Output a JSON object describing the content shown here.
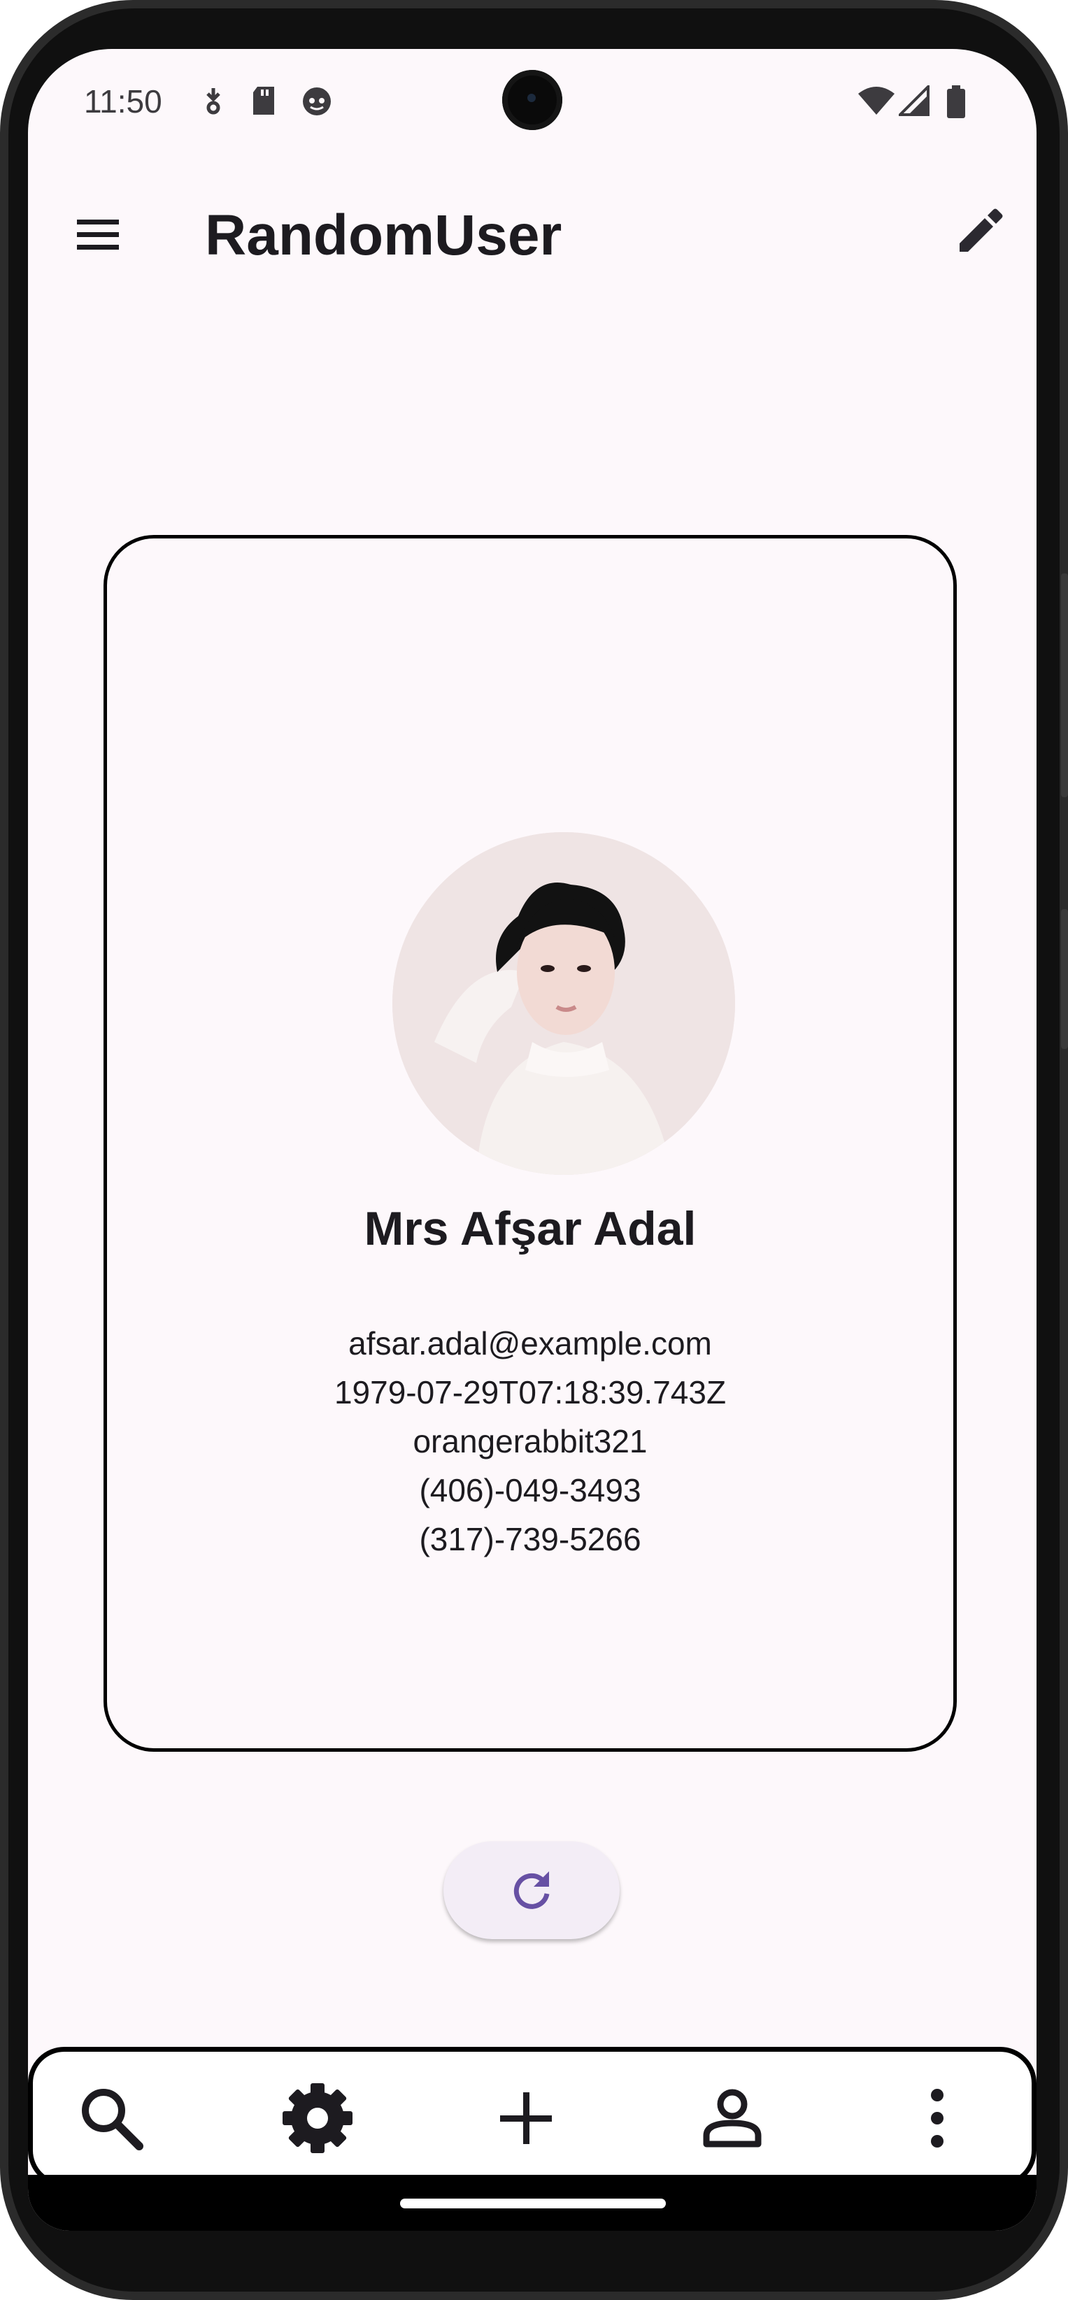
{
  "status_bar": {
    "time": "11:50",
    "left_icons": [
      "download-status-icon",
      "sd-card-icon",
      "app-notification-icon"
    ],
    "right_icons": [
      "wifi-icon",
      "cellular-signal-icon",
      "battery-icon"
    ]
  },
  "app_bar": {
    "title": "RandomUser",
    "leading_icon": "menu-icon",
    "trailing_icon": "edit-icon"
  },
  "user_card": {
    "name": "Mrs Afşar Adal",
    "email": "afsar.adal@example.com",
    "dob": "1979-07-29T07:18:39.743Z",
    "username": "orangerabbit321",
    "phone": "(406)-049-3493",
    "cell": "(317)-739-5266"
  },
  "refresh_button": {
    "icon": "refresh-icon",
    "accent": "#6750a4"
  },
  "bottom_bar": {
    "items": [
      {
        "icon": "search-icon"
      },
      {
        "icon": "settings-gear-icon"
      },
      {
        "icon": "add-icon"
      },
      {
        "icon": "person-icon"
      },
      {
        "icon": "more-vert-icon"
      }
    ]
  },
  "colors": {
    "background": "#fdf8fb",
    "text": "#1d1b20",
    "card_border": "#000000",
    "accent": "#6750a4",
    "button_surface": "#f3edf6"
  }
}
